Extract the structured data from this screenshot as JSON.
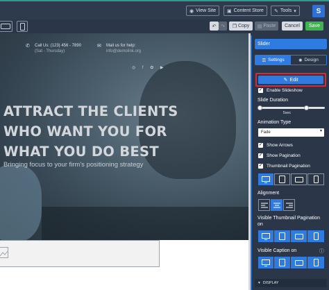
{
  "topbar": {
    "view_site": "View Site",
    "content_store": "Content Store",
    "tools": "Tools",
    "avatar": "S"
  },
  "toolbar": {
    "copy": "Copy",
    "paste": "Paste",
    "cancel": "Cancel",
    "save": "Save"
  },
  "hero": {
    "phone_label": "Call Us: (123) 456 - 7890",
    "phone_hours": "(Sat - Thursday)",
    "mail_label": "Mail us for help:",
    "mail_address": "info@demolink.org",
    "social": "◎ f ✿ ▶",
    "headline_1": "ATTRACT THE CLIENTS",
    "headline_2": "WHO WANT YOU FOR",
    "headline_3": "WHAT YOU DO BEST",
    "tagline": "Bringing focus to your firm's positioning strategy"
  },
  "panel": {
    "title": "Slider",
    "tab_settings": "Settings",
    "tab_design": "Design",
    "edit": "Edit",
    "enable_slideshow": "Enable Slideshow",
    "slide_duration": "Slide Duration",
    "slide_duration_value": "5sec",
    "slide_duration_fraction": 0.72,
    "animation_type": "Animation Type",
    "animation_value": "Fade",
    "show_arrows": "Show Arrows",
    "show_pagination": "Show Pagination",
    "thumbnail_pagination": "Thumbnail Pagination",
    "alignment": "Alignment",
    "visible_thumb_pagination": "Visible Thumbnail Pagination on",
    "visible_caption": "Visible Caption on",
    "display": "DISPLAY"
  },
  "colors": {
    "accent": "#2f7be0",
    "save": "#3cb54a",
    "highlight": "#d62b3d",
    "teal": "#2a9d8f"
  }
}
